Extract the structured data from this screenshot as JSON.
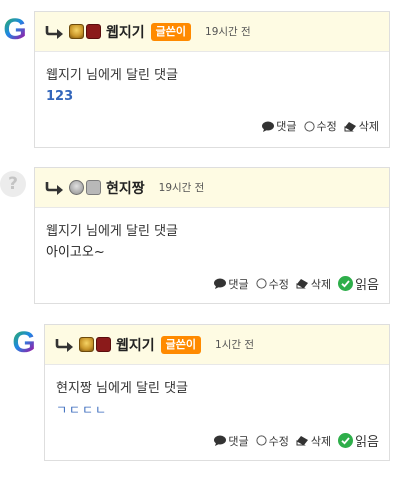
{
  "comments": [
    {
      "author": "웹지기",
      "badge": "글쓴이",
      "time": "19시간 전",
      "target": "웹지기 님에게 달린 댓글",
      "text": "123",
      "actions": {
        "reply": "댓글",
        "edit": "수정",
        "delete": "삭제"
      }
    },
    {
      "author": "현지짱",
      "time": "19시간 전",
      "target": "웹지기 님에게 달린 댓글",
      "text": "아이고오~",
      "actions": {
        "reply": "댓글",
        "edit": "수정",
        "delete": "삭제",
        "read": "읽음"
      }
    },
    {
      "author": "웹지기",
      "badge": "글쓴이",
      "time": "1시간 전",
      "target": "현지짱 님에게 달린 댓글",
      "text": "ㄱㄷㄷㄴ",
      "actions": {
        "reply": "댓글",
        "edit": "수정",
        "delete": "삭제",
        "read": "읽음"
      }
    }
  ],
  "avatar_glyphs": {
    "g": "G",
    "unknown": "?"
  },
  "colors": {
    "header_bg": "#fefbe3",
    "badge": "#ff8a00",
    "link_blue": "#3366bb",
    "read_green": "#2eae4a"
  }
}
